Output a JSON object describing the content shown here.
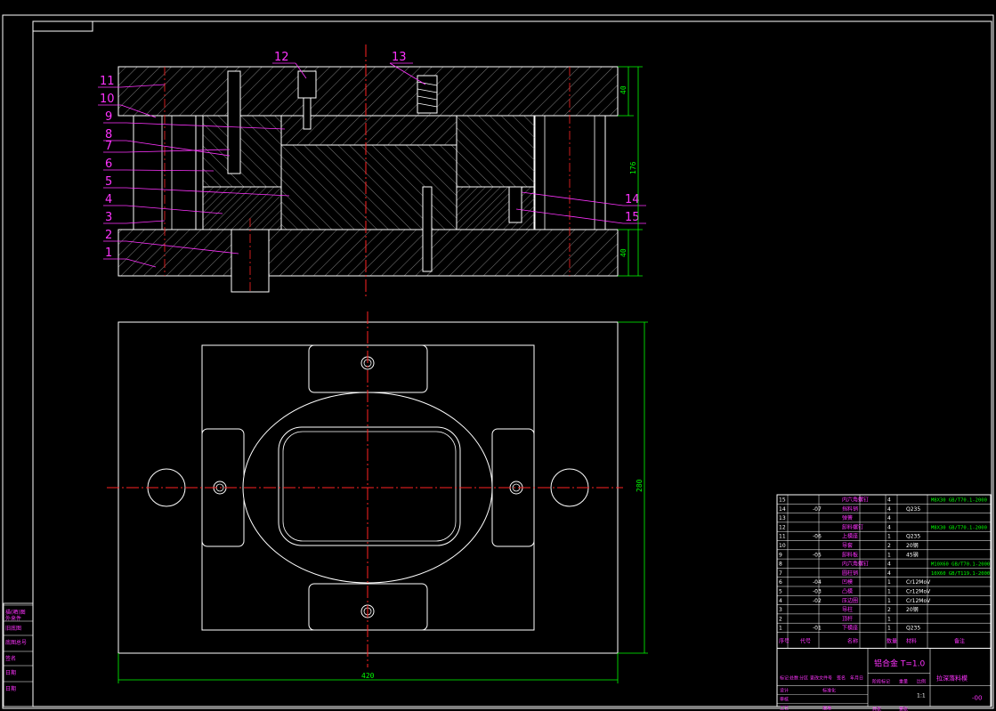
{
  "colors": {
    "background": "#000000",
    "outline": "#ffffff",
    "hatch": "#9a9a9a",
    "leader": "#ff33ff",
    "centerline": "#ff2222",
    "dimension": "#00ff00",
    "border": "#ffffff"
  },
  "callouts": [
    "1",
    "2",
    "3",
    "4",
    "5",
    "6",
    "7",
    "8",
    "9",
    "10",
    "11",
    "12",
    "13",
    "14",
    "15"
  ],
  "dimensions": {
    "top_plate": "40",
    "total_height": "176",
    "bottom_plate": "40",
    "plan_width": "420",
    "plan_height": "280"
  },
  "side_block": [
    "描(晒)图",
    "旧底图",
    "底图总号",
    "签名",
    "日期",
    "日期"
  ],
  "side_block_extra": "外来件",
  "bom": {
    "rows": [
      {
        "no": "15",
        "code": "",
        "name": "内六角螺钉",
        "qty": "4",
        "material": "",
        "std": "M8X30 GB/T70.1-2000"
      },
      {
        "no": "14",
        "code": "-07",
        "name": "挡料销",
        "qty": "4",
        "material": "Q235",
        "std": ""
      },
      {
        "no": "13",
        "code": "",
        "name": "弹簧",
        "qty": "4",
        "material": "",
        "std": ""
      },
      {
        "no": "12",
        "code": "",
        "name": "卸料螺钉",
        "qty": "4",
        "material": "",
        "std": "M8X30 GB/T70.1-2000"
      },
      {
        "no": "11",
        "code": "-06",
        "name": "上模座",
        "qty": "1",
        "material": "Q235",
        "std": ""
      },
      {
        "no": "10",
        "code": "",
        "name": "导套",
        "qty": "2",
        "material": "20钢",
        "std": ""
      },
      {
        "no": "9",
        "code": "-05",
        "name": "卸料板",
        "qty": "1",
        "material": "45钢",
        "std": ""
      },
      {
        "no": "8",
        "code": "",
        "name": "内六角螺钉",
        "qty": "4",
        "material": "",
        "std": "M10X60 GB/T70.1-2000"
      },
      {
        "no": "7",
        "code": "",
        "name": "圆柱销",
        "qty": "4",
        "material": "",
        "std": "10X60 GB/T119.1-2000"
      },
      {
        "no": "6",
        "code": "-04",
        "name": "凹模",
        "qty": "1",
        "material": "Cr12MoV",
        "std": ""
      },
      {
        "no": "5",
        "code": "-03",
        "name": "凸模",
        "qty": "1",
        "material": "Cr12MoV",
        "std": ""
      },
      {
        "no": "4",
        "code": "-02",
        "name": "压边圈",
        "qty": "1",
        "material": "Cr12MoV",
        "std": ""
      },
      {
        "no": "3",
        "code": "",
        "name": "导柱",
        "qty": "2",
        "material": "20钢",
        "std": ""
      },
      {
        "no": "2",
        "code": "",
        "name": "顶杆",
        "qty": "1",
        "material": "",
        "std": ""
      },
      {
        "no": "1",
        "code": "-01",
        "name": "下模座",
        "qty": "1",
        "material": "Q235",
        "std": ""
      }
    ],
    "header": {
      "no": "序号",
      "code": "代号",
      "name": "名称",
      "qty": "数量",
      "material": "材料",
      "note": "备注"
    }
  },
  "title_block": {
    "material": "铝合金 T=1.0",
    "drawing_name": "拉深落料模",
    "drawing_no": "-00",
    "labels": [
      "标记",
      "处数",
      "分区",
      "更改文件号",
      "签名",
      "年月日",
      "设计",
      "标准化",
      "审核",
      "工艺",
      "批准",
      "阶段标记",
      "重量",
      "比例",
      "共张",
      "第张"
    ],
    "scale": "1:1"
  }
}
